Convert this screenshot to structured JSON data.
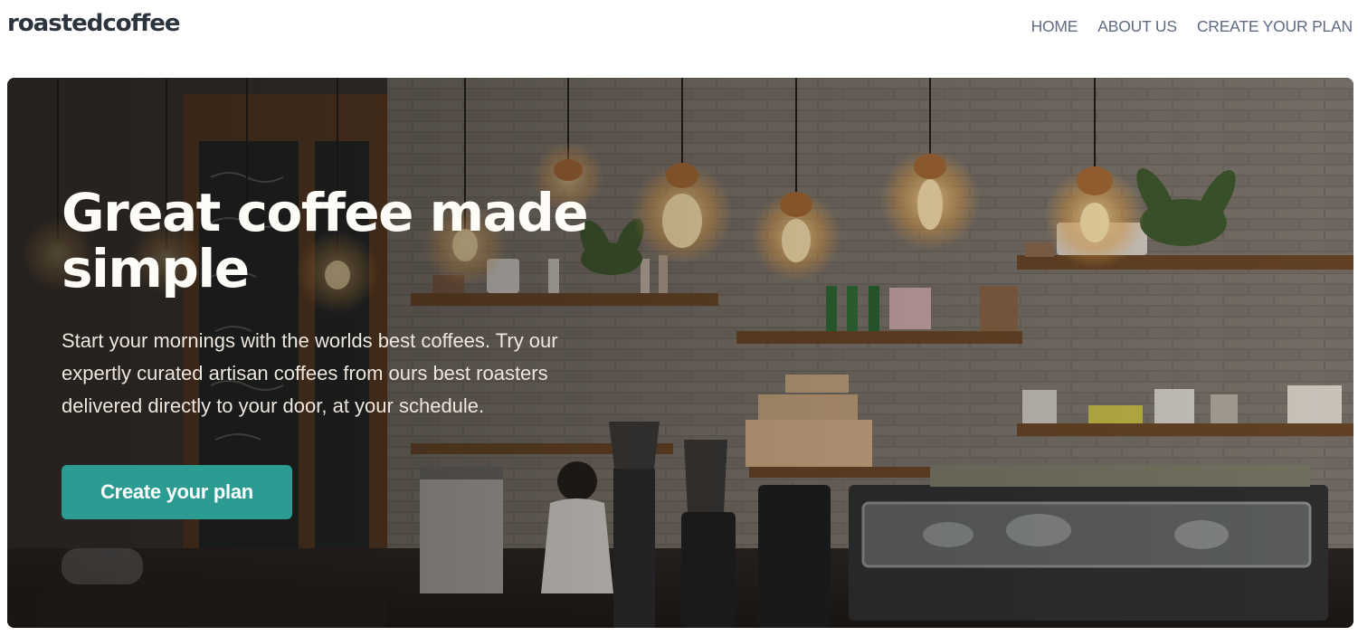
{
  "brand": {
    "logo_text": "roastedcoffee"
  },
  "nav": {
    "items": [
      "HOME",
      "ABOUT US",
      "CREATE YOUR PLAN"
    ]
  },
  "hero": {
    "title_line1": "Great coffee made",
    "title_line2": "simple",
    "description_line1": "Start your mornings with the worlds best coffees. Try our",
    "description_line2": "expertly curated artisan coffees from ours best roasters",
    "description_line3": "delivered directly to your door, at your schedule.",
    "cta_label": "Create your plan"
  },
  "colors": {
    "accent": "#2c9c93",
    "logo": "#2c343e",
    "nav_text": "#5f6b82",
    "hero_text": "#fefcf7"
  }
}
